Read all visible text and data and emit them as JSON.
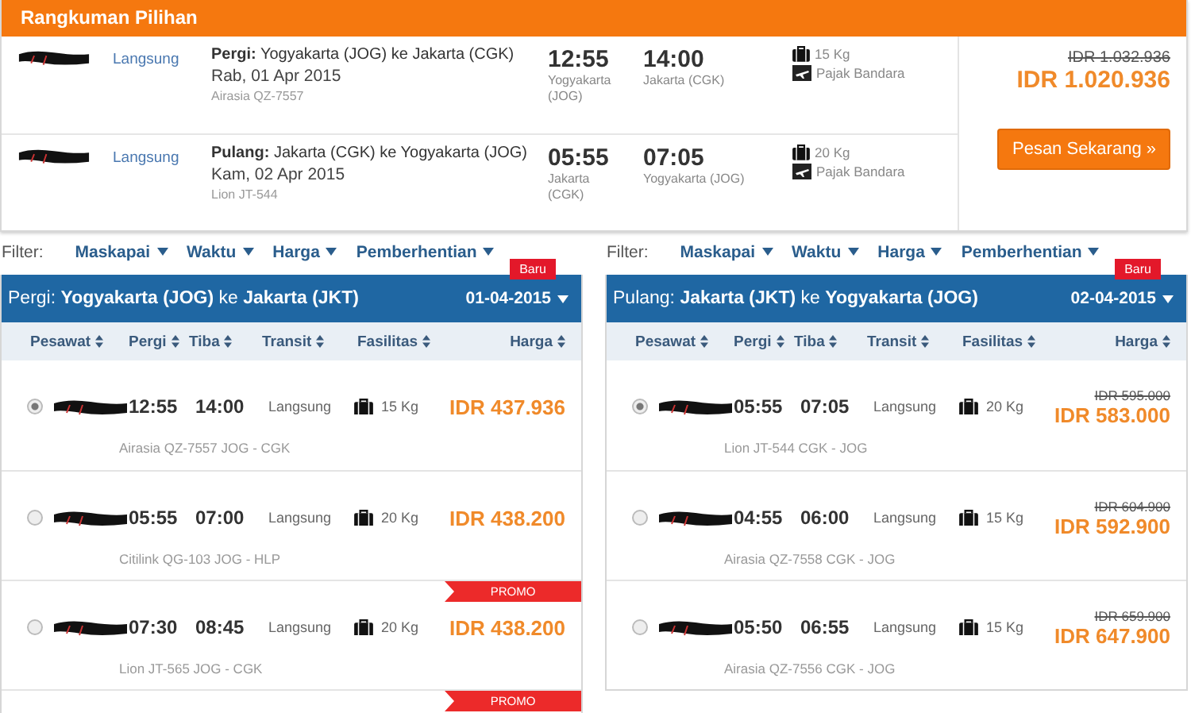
{
  "summary": {
    "title": "Rangkuman Pilihan",
    "flights": [
      {
        "transit": "Langsung",
        "route": "**Pergi:** Yogyakarta (JOG) ke Jakarta (CGK)",
        "date": "Rab, 01 Apr 2015",
        "flight": "Airasia QZ-7557",
        "depart": "12:55",
        "depart_city": "Yogyakarta (JOG)",
        "arrive": "14:00",
        "arrive_city": "Jakarta (CGK)",
        "baggage": "15 Kg",
        "tax": "Pajak Bandara"
      },
      {
        "transit": "Langsung",
        "route": "**Pulang:** Jakarta (CGK) ke Yogyakarta (JOG)",
        "date": "Kam, 02 Apr 2015",
        "flight": "Lion JT-544",
        "depart": "05:55",
        "depart_city": "Jakarta (CGK)",
        "arrive": "07:05",
        "arrive_city": "Yogyakarta (JOG)",
        "baggage": "20 Kg",
        "tax": "Pajak Bandara"
      }
    ],
    "old_price": "IDR 1.032.936",
    "price": "IDR 1.020.936",
    "book_button": "Pesan Sekarang »"
  },
  "panels": [
    {
      "filter_label": "Filter:",
      "filters": [
        "Maskapai",
        "Waktu",
        "Harga",
        "Pemberhentian"
      ],
      "route": "Pergi: **Yogyakarta (JOG)** ke **Jakarta (JKT)**",
      "date": "01-04-2015",
      "badge": "Baru",
      "columns": [
        "Pesawat",
        "Pergi",
        "Tiba",
        "Transit",
        "Fasilitas",
        "Harga"
      ],
      "rows": [
        {
          "kind": "flight",
          "selected": true,
          "depart": "12:55",
          "arrive": "14:00",
          "transit": "Langsung",
          "baggage": "15 Kg",
          "price": "IDR 437.936",
          "flight": "Airasia QZ-7557 JOG - CGK"
        },
        {
          "kind": "flight",
          "selected": false,
          "depart": "05:55",
          "arrive": "07:00",
          "transit": "Langsung",
          "baggage": "20 Kg",
          "price": "IDR 438.200",
          "flight": "Citilink QG-103 JOG - HLP"
        },
        {
          "kind": "flight",
          "selected": false,
          "promo": "PROMO",
          "depart": "07:30",
          "arrive": "08:45",
          "transit": "Langsung",
          "baggage": "20 Kg",
          "price": "IDR 438.200",
          "flight": "Lion JT-565 JOG - CGK"
        },
        {
          "kind": "partial",
          "promo": "PROMO"
        }
      ]
    },
    {
      "filter_label": "Filter:",
      "filters": [
        "Maskapai",
        "Waktu",
        "Harga",
        "Pemberhentian"
      ],
      "route": "Pulang: **Jakarta (JKT)** ke **Yogyakarta (JOG)**",
      "date": "02-04-2015",
      "badge": "Baru",
      "columns": [
        "Pesawat",
        "Pergi",
        "Tiba",
        "Transit",
        "Fasilitas",
        "Harga"
      ],
      "rows": [
        {
          "kind": "flight",
          "selected": true,
          "depart": "05:55",
          "arrive": "07:05",
          "transit": "Langsung",
          "baggage": "20 Kg",
          "old_price": "IDR 595.000",
          "price": "IDR 583.000",
          "flight": "Lion JT-544 CGK - JOG"
        },
        {
          "kind": "flight",
          "selected": false,
          "depart": "04:55",
          "arrive": "06:00",
          "transit": "Langsung",
          "baggage": "15 Kg",
          "old_price": "IDR 604.900",
          "price": "IDR 592.900",
          "flight": "Airasia QZ-7558 CGK - JOG"
        },
        {
          "kind": "flight",
          "selected": false,
          "depart": "05:50",
          "arrive": "06:55",
          "transit": "Langsung",
          "baggage": "15 Kg",
          "old_price": "IDR 659.900",
          "price": "IDR 647.900",
          "flight": "Airasia QZ-7556 CGK - JOG"
        }
      ]
    }
  ]
}
